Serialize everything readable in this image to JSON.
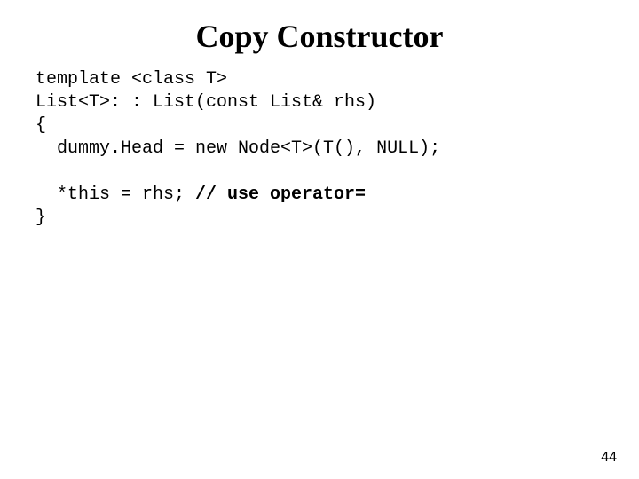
{
  "title": "Copy Constructor",
  "code": {
    "line1": "template <class T>",
    "line2": "List<T>: : List(const List& rhs)",
    "line3": "{",
    "line4": "  dummy.Head = new Node<T>(T(), NULL);",
    "line5": "",
    "line6_a": "  *this = rhs; ",
    "line6_b": "// use operator=",
    "line7": "}"
  },
  "page_number": "44"
}
